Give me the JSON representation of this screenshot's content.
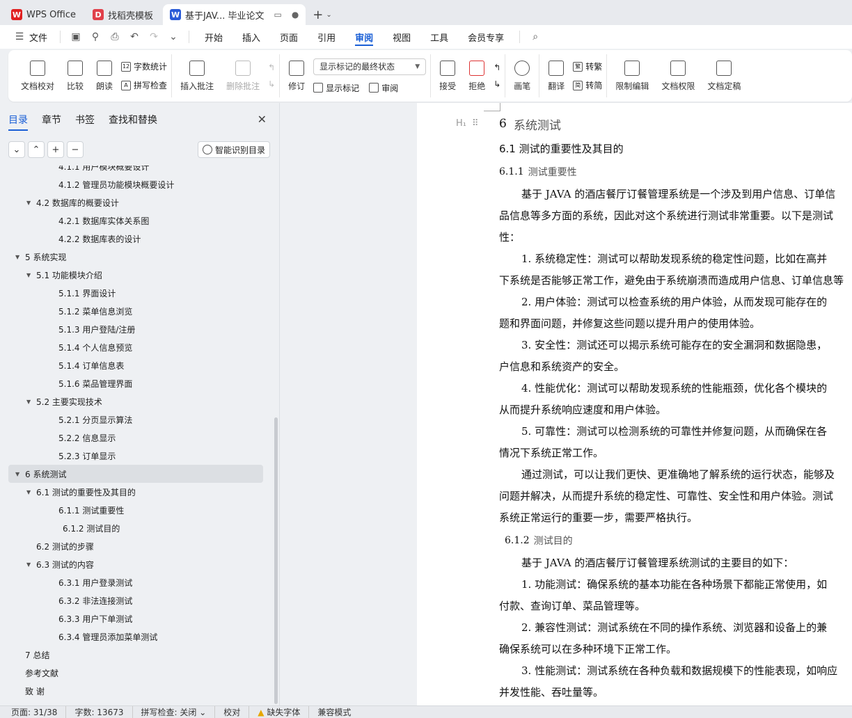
{
  "titlebar": {
    "tabs": [
      {
        "label": "WPS Office",
        "icon": "wps-logo-icon",
        "color": "#e02020"
      },
      {
        "label": "找稻壳模板",
        "icon": "docer-icon",
        "color": "#e0404a"
      },
      {
        "label": "基于JAV... 毕业论文",
        "icon": "writer-icon",
        "color": "#2a5bd7"
      }
    ],
    "add_label": "+"
  },
  "menubar": {
    "file_label": "文件",
    "items": [
      "开始",
      "插入",
      "页面",
      "引用",
      "审阅",
      "视图",
      "工具",
      "会员专享"
    ],
    "active": "审阅"
  },
  "ribbon": {
    "doc_check": "文档校对",
    "compare": "比较",
    "read_aloud": "朗读",
    "word_count": "字数统计",
    "spell_check": "拼写检查",
    "insert_comment": "插入批注",
    "delete_comment": "删除批注",
    "revise": "修订",
    "display_select": "显示标记的最终状态",
    "show_marks": "显示标记",
    "review": "审阅",
    "accept": "接受",
    "reject": "拒绝",
    "pen": "画笔",
    "translate": "翻译",
    "to_traditional": "转繁",
    "to_simplified": "转简",
    "restrict_edit": "限制编辑",
    "doc_permission": "文档权限",
    "doc_finalize": "文档定稿"
  },
  "nav": {
    "tabs": [
      "目录",
      "章节",
      "书签",
      "查找和替换"
    ],
    "active_tab": "目录",
    "smart_toc": "智能识别目录",
    "toc": [
      {
        "label": "4.1.1 用户模块概要设计",
        "level": 3
      },
      {
        "label": "4.1.2 管理员功能模块概要设计",
        "level": 3
      },
      {
        "label": "4.2 数据库的概要设计",
        "level": 2,
        "expanded": true
      },
      {
        "label": "4.2.1 数据库实体关系图",
        "level": 3
      },
      {
        "label": "4.2.2 数据库表的设计",
        "level": 3
      },
      {
        "label": "5  系统实现",
        "level": 1,
        "expanded": true
      },
      {
        "label": "5.1 功能模块介绍",
        "level": 2,
        "expanded": true
      },
      {
        "label": "5.1.1 界面设计",
        "level": 3
      },
      {
        "label": "5.1.2  菜单信息浏览",
        "level": 3
      },
      {
        "label": "5.1.3  用户登陆/注册",
        "level": 3
      },
      {
        "label": "5.1.4  个人信息预览",
        "level": 3
      },
      {
        "label": "5.1.4  订单信息表",
        "level": 3
      },
      {
        "label": "5.1.6  菜品管理界面",
        "level": 3
      },
      {
        "label": "5.2 主要实现技术",
        "level": 2,
        "expanded": true
      },
      {
        "label": "5.2.1 分页显示算法",
        "level": 3
      },
      {
        "label": "5.2.2  信息显示",
        "level": 3
      },
      {
        "label": "5.2.3  订单显示",
        "level": 3
      },
      {
        "label": "6  系统测试",
        "level": 1,
        "expanded": true,
        "selected": true
      },
      {
        "label": "6.1 测试的重要性及其目的",
        "level": 2,
        "expanded": true
      },
      {
        "label": "6.1.1 测试重要性",
        "level": 3
      },
      {
        "label": "6.1.2 测试目的",
        "level": 3,
        "extra_indent": true
      },
      {
        "label": "6.2 测试的步骤",
        "level": 2
      },
      {
        "label": "6.3 测试的内容",
        "level": 2,
        "expanded": true
      },
      {
        "label": "6.3.1 用户登录测试",
        "level": 3
      },
      {
        "label": "6.3.2 非法连接测试",
        "level": 3
      },
      {
        "label": "6.3.3  用户下单测试",
        "level": 3
      },
      {
        "label": "6.3.4  管理员添加菜单测试",
        "level": 3
      },
      {
        "label": "7 总结",
        "level": 1
      },
      {
        "label": "参考文献",
        "level": 1
      },
      {
        "label": "致  谢",
        "level": 1
      }
    ]
  },
  "document": {
    "h1_num": "6",
    "h1_text": "系统测试",
    "h2": "6.1 测试的重要性及其目的",
    "h3a_num": "6.1.1",
    "h3a_text": "测试重要性",
    "lines_a": [
      {
        "text": "基于 JAVA 的酒店餐厅订餐管理系统是一个涉及到用户信息、订单信",
        "indent": true
      },
      {
        "text": "品信息等多方面的系统，因此对这个系统进行测试非常重要。以下是测试",
        "indent": false
      },
      {
        "text": "性：",
        "indent": false
      },
      {
        "text": "1. 系统稳定性：测试可以帮助发现系统的稳定性问题，比如在高并",
        "indent": true
      },
      {
        "text": "下系统是否能够正常工作，避免由于系统崩溃而造成用户信息、订单信息等",
        "indent": false
      },
      {
        "text": "2. 用户体验：测试可以检查系统的用户体验，从而发现可能存在的",
        "indent": true
      },
      {
        "text": "题和界面问题，并修复这些问题以提升用户的使用体验。",
        "indent": false
      },
      {
        "text": "3. 安全性：测试还可以揭示系统可能存在的安全漏洞和数据隐患，",
        "indent": true
      },
      {
        "text": "户信息和系统资产的安全。",
        "indent": false
      },
      {
        "text": "4. 性能优化：测试可以帮助发现系统的性能瓶颈，优化各个模块的",
        "indent": true
      },
      {
        "text": "从而提升系统响应速度和用户体验。",
        "indent": false
      },
      {
        "text": "5. 可靠性：测试可以检测系统的可靠性并修复问题，从而确保在各",
        "indent": true
      },
      {
        "text": "情况下系统正常工作。",
        "indent": false
      },
      {
        "text": "通过测试，可以让我们更快、更准确地了解系统的运行状态，能够及",
        "indent": true
      },
      {
        "text": "问题并解决，从而提升系统的稳定性、可靠性、安全性和用户体验。测试",
        "indent": false
      },
      {
        "text": "系统正常运行的重要一步，需要严格执行。",
        "indent": false
      }
    ],
    "h3b_num": "6.1.2",
    "h3b_text": "测试目的",
    "lines_b": [
      {
        "text": "基于 JAVA 的酒店餐厅订餐管理系统测试的主要目的如下：",
        "indent": true
      },
      {
        "text": "1. 功能测试：确保系统的基本功能在各种场景下都能正常使用，如",
        "indent": true
      },
      {
        "text": "付款、查询订单、菜品管理等。",
        "indent": false
      },
      {
        "text": "2. 兼容性测试：测试系统在不同的操作系统、浏览器和设备上的兼",
        "indent": true
      },
      {
        "text": "确保系统可以在多种环境下正常工作。",
        "indent": false
      },
      {
        "text": "3. 性能测试：测试系统在各种负载和数据规模下的性能表现，如响应",
        "indent": true
      },
      {
        "text": "并发性能、吞吐量等。",
        "indent": false
      }
    ]
  },
  "statusbar": {
    "page": "页面: 31/38",
    "words": "字数: 13673",
    "spell": "拼写检查: 关闭",
    "proof": "校对",
    "missing_font": "缺失字体",
    "compat": "兼容模式"
  }
}
